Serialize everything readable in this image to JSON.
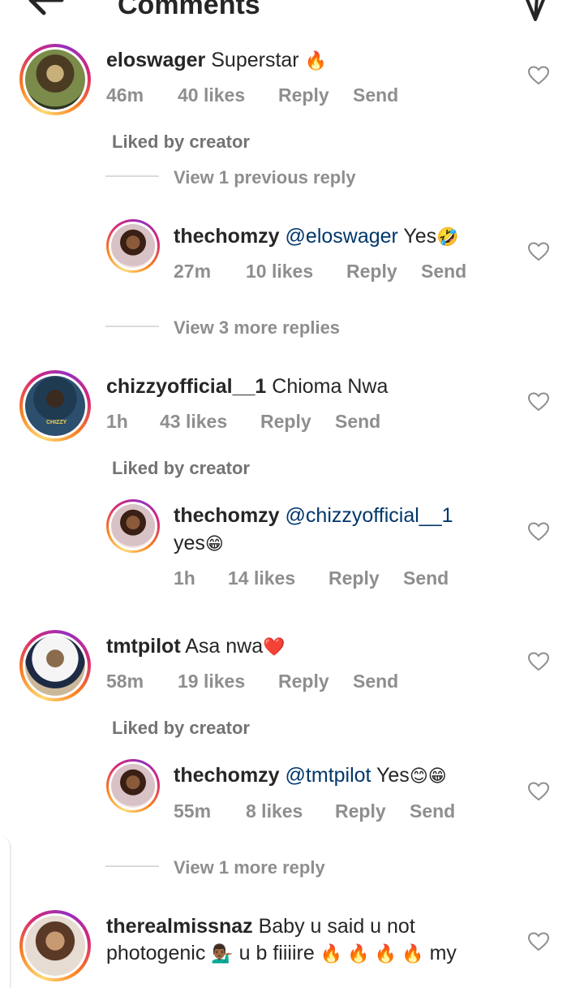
{
  "header": {
    "title": "Comments"
  },
  "comments": [
    {
      "username": "eloswager",
      "text": "Superstar",
      "emoji": "🔥",
      "time": "46m",
      "likes": "40 likes",
      "reply": "Reply",
      "send": "Send",
      "liked_by": "Liked by creator",
      "view_replies": "View 1 previous reply"
    },
    {
      "username": "thechomzy",
      "mention": "@eloswager",
      "text": "Yes",
      "emoji": "🤣",
      "time": "27m",
      "likes": "10 likes",
      "reply": "Reply",
      "send": "Send",
      "view_replies": "View 3 more replies"
    },
    {
      "username": "chizzyofficial__1",
      "text": "Chioma Nwa",
      "time": "1h",
      "likes": "43 likes",
      "reply": "Reply",
      "send": "Send",
      "liked_by": "Liked by creator",
      "avatar_caption": "CHIZZY"
    },
    {
      "username": "thechomzy",
      "mention": "@chizzyofficial__1",
      "text": "yes",
      "emoji": "😁",
      "time": "1h",
      "likes": "14 likes",
      "reply": "Reply",
      "send": "Send"
    },
    {
      "username": "tmtpilot",
      "text": "Asa nwa",
      "emoji": "❤️",
      "time": "58m",
      "likes": "19 likes",
      "reply": "Reply",
      "send": "Send",
      "liked_by": "Liked by creator"
    },
    {
      "username": "thechomzy",
      "mention": "@tmtpilot",
      "text": "Yes",
      "emoji": "😊😁",
      "time": "55m",
      "likes": "8 likes",
      "reply": "Reply",
      "send": "Send",
      "view_replies": "View 1 more reply"
    },
    {
      "username": "therealmissnaz",
      "text": "Baby u said u not",
      "text_line2": "photogenic",
      "emoji": "💁🏾‍♂️",
      "text_line2_b": "u b fiiiire",
      "fire_emojis": "🔥 🔥 🔥 🔥",
      "text_line2_c": "my"
    }
  ],
  "colors": {
    "mention": "#00376b",
    "meta": "#8e8e8e",
    "text": "#262626"
  }
}
